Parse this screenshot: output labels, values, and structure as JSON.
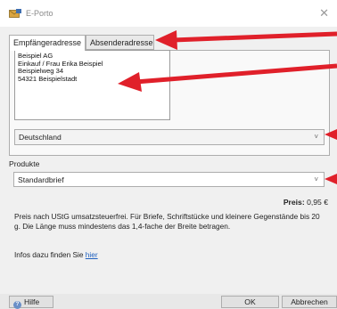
{
  "window": {
    "title": "E-Porto",
    "close_glyph": "✕"
  },
  "tabs": [
    {
      "label": "Empfängeradresse",
      "active": true
    },
    {
      "label": "Absenderadresse",
      "active": false
    }
  ],
  "address": {
    "text": "Beispiel AG\nEinkauf / Frau Erika Beispiel\nBeispielweg 34\n54321 Beispielstadt"
  },
  "country": {
    "value": "Deutschland",
    "chevron": "˅"
  },
  "products": {
    "label": "Produkte",
    "value": "Standardbrief",
    "chevron": "˅",
    "price_label": "Preis:",
    "price_value": "0,95 €"
  },
  "info": {
    "text": "Preis nach UStG umsatzsteuerfrei. Für Briefe, Schriftstücke und kleinere Gegenstände bis 20 g. Die Länge muss mindestens das 1,4-fache der Breite betragen.",
    "link_prefix": "Infos dazu finden Sie ",
    "link_text": "hier"
  },
  "buttons": {
    "help": "Hilfe",
    "ok": "OK",
    "cancel": "Abbrechen"
  },
  "colors": {
    "annotation_arrow": "#e0202a",
    "link": "#1d5fbf"
  },
  "icons": {
    "app": "envelope-stamp-icon",
    "help": "help-icon",
    "close": "close-icon"
  }
}
